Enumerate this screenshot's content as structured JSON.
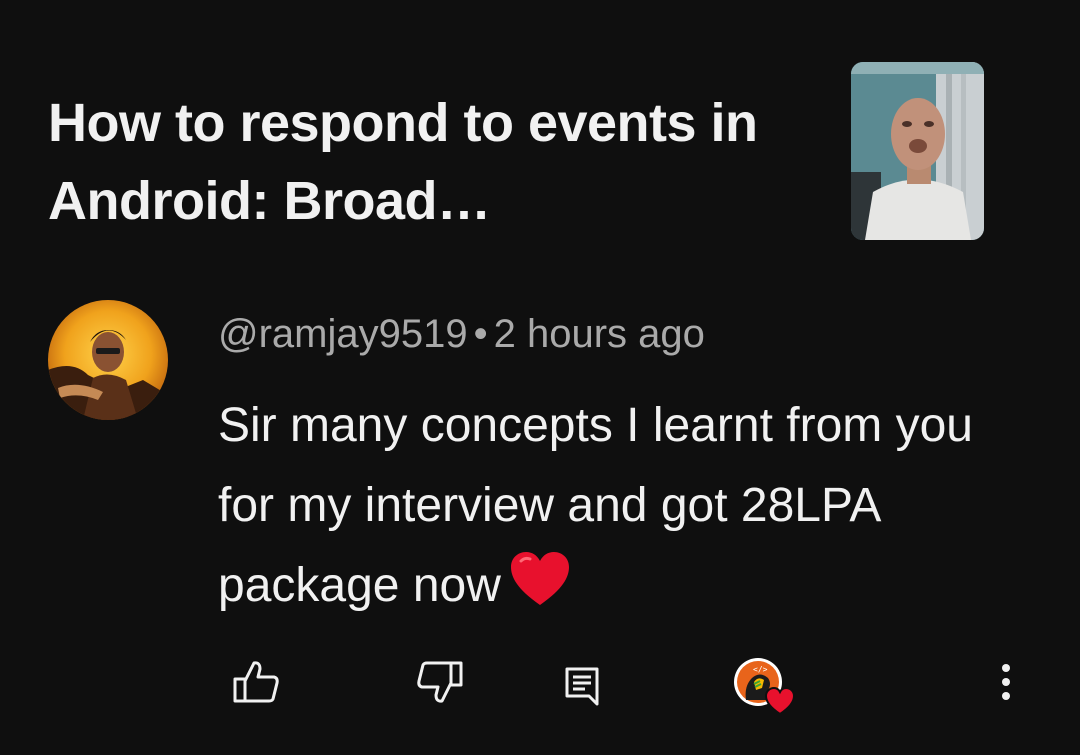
{
  "video": {
    "title": "How to respond to events in Android: Broad…"
  },
  "comment": {
    "author": "@ramjay9519",
    "separator": "•",
    "time": "2 hours ago",
    "text": "Sir many concepts I learnt from you for my interview and got 28LPA package now"
  },
  "icons": {
    "like": "thumb-up-icon",
    "dislike": "thumb-down-icon",
    "reply": "comment-reply-icon",
    "creator_heart": "creator-heart-icon",
    "more": "more-vertical-icon",
    "emoji": "red-heart-emoji-icon"
  },
  "colors": {
    "background": "#0f0f0f",
    "primary_text": "#f1f1f1",
    "secondary_text": "#aaaaaa",
    "heart": "#e8112d"
  }
}
